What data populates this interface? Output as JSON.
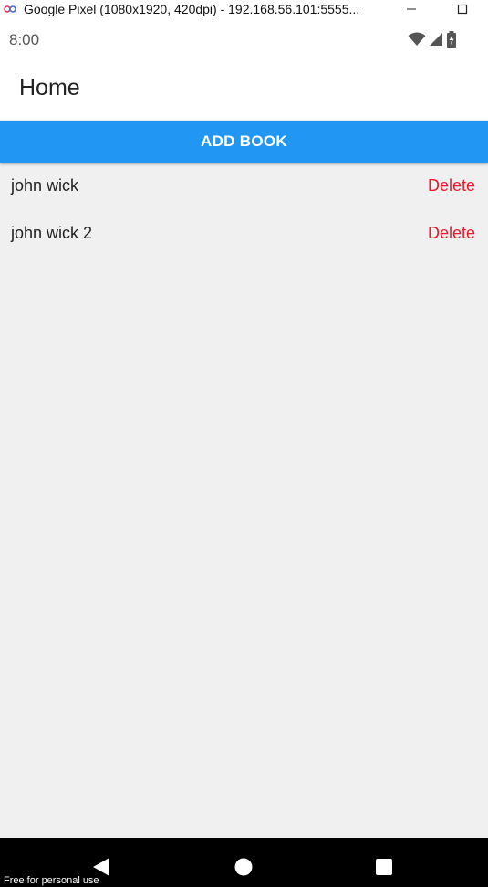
{
  "window": {
    "title": "Google Pixel (1080x1920, 420dpi) - 192.168.56.101:5555...",
    "app_icon": "genymotion-logo-icon",
    "controls": [
      "minimize-icon",
      "maximize-icon"
    ]
  },
  "status_bar": {
    "time": "8:00",
    "icons": [
      "wifi-icon",
      "cellular-signal-icon",
      "battery-charging-icon"
    ]
  },
  "app_bar": {
    "title": "Home"
  },
  "toolbar": {
    "add_book_label": "ADD BOOK",
    "accent_color": "#2196f3"
  },
  "books": [
    {
      "title": "john wick",
      "delete_label": "Delete"
    },
    {
      "title": "john wick 2",
      "delete_label": "Delete"
    }
  ],
  "colors": {
    "delete": "#f2162b",
    "background": "#f0f0f0"
  },
  "nav_bar": {
    "icons": [
      "back-icon",
      "home-icon",
      "recents-icon"
    ]
  },
  "watermark": "Free for personal use"
}
